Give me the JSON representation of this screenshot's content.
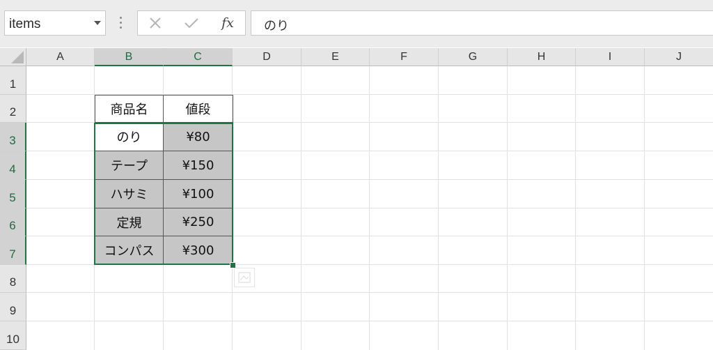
{
  "name_box": {
    "value": "items"
  },
  "formula_bar": {
    "cancel_icon": "x-icon",
    "enter_icon": "check-icon",
    "fx_label": "fx",
    "value": "のり"
  },
  "columns": [
    "A",
    "B",
    "C",
    "D",
    "E",
    "F",
    "G",
    "H",
    "I",
    "J"
  ],
  "selected_columns": [
    "B",
    "C"
  ],
  "rows": [
    "1",
    "2",
    "3",
    "4",
    "5",
    "6",
    "7",
    "8",
    "9",
    "10"
  ],
  "selected_rows": [
    "3",
    "4",
    "5",
    "6",
    "7"
  ],
  "table": {
    "headers": [
      "商品名",
      "値段"
    ],
    "rows": [
      [
        "のり",
        "¥80"
      ],
      [
        "テープ",
        "¥150"
      ],
      [
        "ハサミ",
        "¥100"
      ],
      [
        "定規",
        "¥250"
      ],
      [
        "コンパス",
        "¥300"
      ]
    ]
  },
  "selection": {
    "range": "B3:C7",
    "active_cell": "B3"
  },
  "colors": {
    "accent": "#217346",
    "selected_fill": "#c6c6c6",
    "ribbon_bg": "#ececec"
  }
}
